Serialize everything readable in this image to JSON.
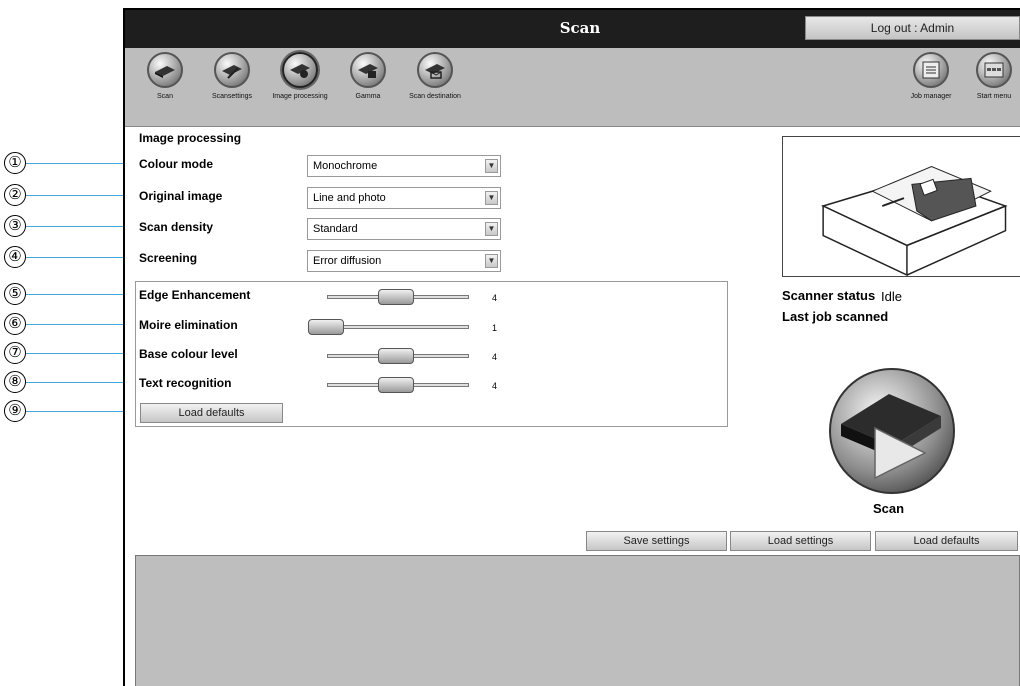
{
  "window": {
    "title": "Scan",
    "logout_label": "Log out : Admin"
  },
  "toolbar": {
    "items": [
      {
        "label": "Scan",
        "icon": "scan-icon"
      },
      {
        "label": "Scansettings",
        "icon": "scansettings-icon"
      },
      {
        "label": "Image processing",
        "icon": "image-processing-icon"
      },
      {
        "label": "Gamma",
        "icon": "gamma-icon"
      },
      {
        "label": "Scan destination",
        "icon": "scan-destination-icon"
      }
    ],
    "right_items": [
      {
        "label": "Job manager",
        "icon": "job-manager-icon"
      },
      {
        "label": "Start menu",
        "icon": "start-menu-icon"
      }
    ]
  },
  "image_processing": {
    "heading": "Image processing",
    "colour_mode": {
      "label": "Colour mode",
      "value": "Monochrome"
    },
    "original_image": {
      "label": "Original image",
      "value": "Line and photo"
    },
    "scan_density": {
      "label": "Scan density",
      "value": "Standard"
    },
    "screening": {
      "label": "Screening",
      "value": "Error diffusion"
    }
  },
  "adjustments": {
    "edge_enhancement": {
      "label": "Edge Enhancement",
      "value": "4",
      "level": 0.5
    },
    "moire_elimination": {
      "label": "Moire elimination",
      "value": "1",
      "level": 0.0
    },
    "base_colour_level": {
      "label": "Base colour level",
      "value": "4",
      "level": 0.5
    },
    "text_recognition": {
      "label": "Text recognition",
      "value": "4",
      "level": 0.5
    },
    "load_defaults_label": "Load defaults"
  },
  "status": {
    "scanner_status_label": "Scanner status",
    "scanner_status_value": "Idle",
    "last_job_label": "Last job scanned",
    "scan_button_label": "Scan"
  },
  "bottom_buttons": {
    "save_settings": "Save settings",
    "load_settings": "Load settings",
    "load_defaults": "Load defaults"
  },
  "callouts": [
    "①",
    "②",
    "③",
    "④",
    "⑤",
    "⑥",
    "⑦",
    "⑧",
    "⑨"
  ],
  "colors": {
    "titlebar": "#1e1e1e",
    "toolbar": "#bdbdbd",
    "callout_line": "#4aa6d9",
    "log_area": "#bebebe"
  }
}
